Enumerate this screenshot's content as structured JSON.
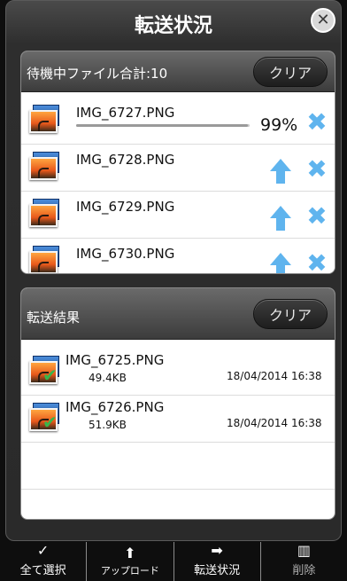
{
  "modal": {
    "title": "転送状況",
    "close_icon": "close-icon"
  },
  "pending": {
    "header_label": "待機中ファイル合計:10",
    "clear_label": "クリア",
    "items": [
      {
        "name": "IMG_6727.PNG",
        "status": "uploading",
        "progress_percent": 99,
        "progress_label": "99%"
      },
      {
        "name": "IMG_6728.PNG",
        "status": "waiting"
      },
      {
        "name": "IMG_6729.PNG",
        "status": "waiting"
      },
      {
        "name": "IMG_6730.PNG",
        "status": "waiting"
      }
    ]
  },
  "results": {
    "header_label": "転送結果",
    "clear_label": "クリア",
    "items": [
      {
        "name": "IMG_6725.PNG",
        "size": "49.4KB",
        "datetime": "18/04/2014 16:38"
      },
      {
        "name": "IMG_6726.PNG",
        "size": "51.9KB",
        "datetime": "18/04/2014 16:38"
      }
    ]
  },
  "toolbar": {
    "select_all": "全て選択",
    "upload": "アップロード",
    "transfer_status": "転送状況",
    "delete": "削除"
  },
  "colors": {
    "accent_blue": "#5fb4ee",
    "check_green": "#39b54a"
  }
}
